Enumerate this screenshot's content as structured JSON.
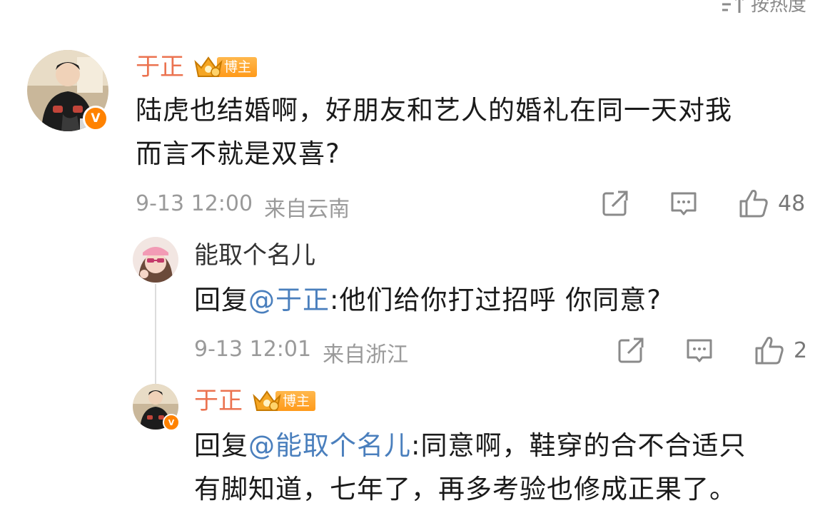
{
  "sort": {
    "label": "按热度",
    "icon": "sort-icon"
  },
  "comments": [
    {
      "username": "于正",
      "badge_label": "博主",
      "verified": "V",
      "text_lines": [
        "陆虎也结婚啊，好朋友和艺人的婚礼在同一天对我",
        "而言不就是双喜?"
      ],
      "time": "9-13 12:00",
      "location": "来自云南",
      "like_count": "48"
    },
    {
      "username": "能取个名儿",
      "reply_prefix": "回复",
      "mention": "@于正",
      "text": ":他们给你打过招呼 你同意?",
      "time": "9-13 12:01",
      "location": "来自浙江",
      "like_count": "2"
    },
    {
      "username": "于正",
      "badge_label": "博主",
      "verified": "V",
      "reply_prefix": "回复",
      "mention": "@能取个名儿",
      "text": ":同意啊，鞋穿的合不合适只",
      "text_line2": "有脚知道，七年了，再多考验也修成正果了。"
    }
  ],
  "colors": {
    "username_orange": "#eb7350",
    "mention_blue": "#4a7fbd",
    "verified_orange": "#ff8200",
    "meta_gray": "#9a9a9a"
  }
}
